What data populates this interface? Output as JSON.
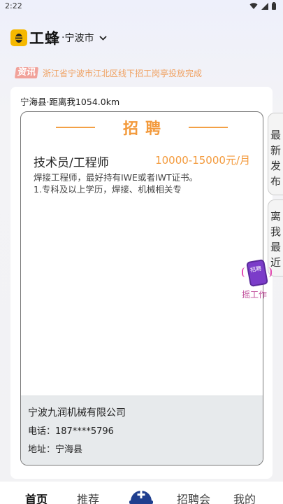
{
  "status_bar": {
    "time": "2:22"
  },
  "header": {
    "logo_text": "工蜂",
    "dot": "·",
    "city": "宁波市"
  },
  "news": {
    "tag": "资讯",
    "text": "浙江省宁波市江北区线下招工岗亭投放完成"
  },
  "card": {
    "location": "宁海县·距离我1054.0km",
    "poster_title": "招聘",
    "job_title": "技术员/工程师",
    "salary": "10000-15000元/月",
    "description_lines": [
      "焊接工程师，最好持有IWE或者IWT证书。",
      "1.专科及以上学历，焊接、机械相关专"
    ],
    "company_name": "宁波九润机械有限公司",
    "phone": "电话：187****5796",
    "address": "地址：宁海县"
  },
  "side_tabs": {
    "latest": [
      "最",
      "新",
      "发",
      "布"
    ],
    "nearest": [
      "离",
      "我",
      "最",
      "近"
    ]
  },
  "shake_widget": {
    "label": "摇工作",
    "phone_text": "招聘"
  },
  "bottom_nav": {
    "home": "首页",
    "recommend": "推荐",
    "fair": "招聘会",
    "mine": "我的"
  },
  "colors": {
    "accent_orange": "#f39a3c",
    "logo_yellow": "#f5b800",
    "news_text": "#f0a060"
  }
}
